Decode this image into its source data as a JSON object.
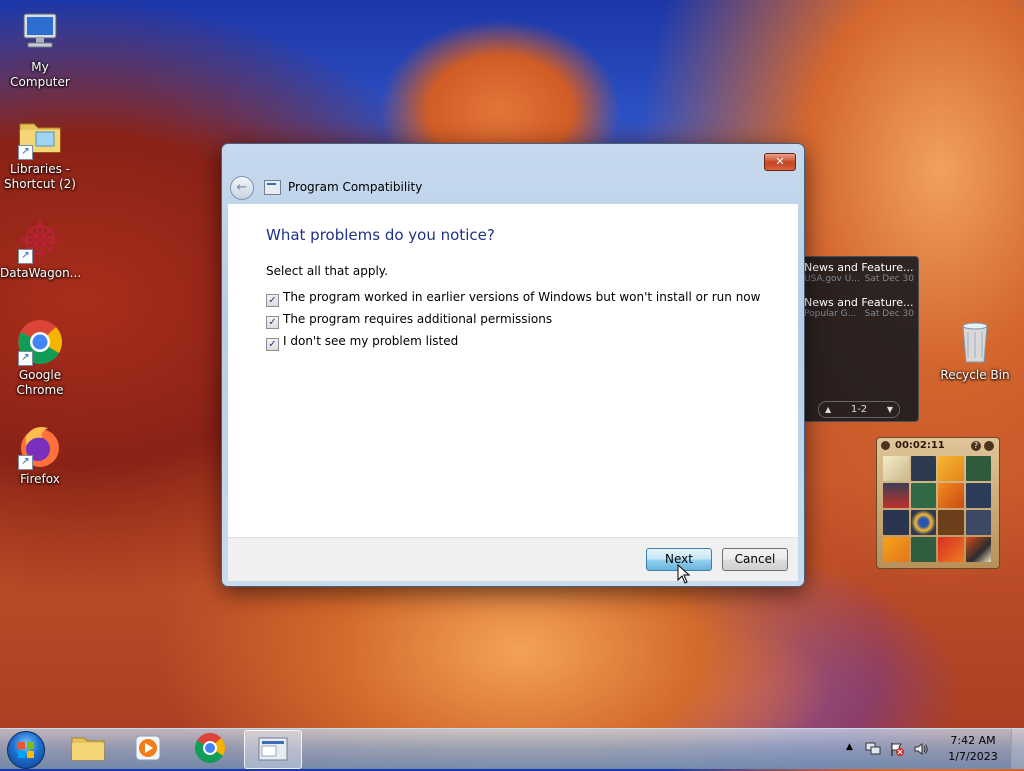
{
  "desktop": {
    "icons": [
      {
        "label": "My Computer"
      },
      {
        "label": "Libraries - Shortcut (2)"
      },
      {
        "label": "DataWagon..."
      },
      {
        "label": "Google Chrome"
      },
      {
        "label": "Firefox"
      },
      {
        "label": "Recycle Bin"
      }
    ]
  },
  "dialog": {
    "title": "Program Compatibility",
    "close_glyph": "✕",
    "back_glyph": "←",
    "heading": "What problems do you notice?",
    "instruction": "Select all that apply.",
    "options": [
      {
        "label": "The program worked in earlier versions of Windows but won't install or run now",
        "checked": true
      },
      {
        "label": "The program requires additional permissions",
        "checked": true
      },
      {
        "label": "I don't see my problem listed",
        "checked": true
      }
    ],
    "next_label": "Next",
    "cancel_label": "Cancel",
    "check_glyph": "✓"
  },
  "feed_gadget": {
    "items": [
      {
        "title": "News and Feature...",
        "source": "USA.gov U...",
        "date": "Sat Dec 30"
      },
      {
        "title": "News and Feature...",
        "source": "Popular G...",
        "date": "Sat Dec 30"
      }
    ],
    "pager": "1-2",
    "prev_glyph": "▲",
    "next_glyph": "▼"
  },
  "puzzle_gadget": {
    "time": "00:02:11"
  },
  "taskbar": {
    "pinned": [
      {
        "name": "windows-explorer"
      },
      {
        "name": "windows-media-player"
      },
      {
        "name": "google-chrome"
      },
      {
        "name": "program-compatibility",
        "active": true
      }
    ],
    "tray_arrow": "▲",
    "clock_time": "7:42 AM",
    "clock_date": "1/7/2023"
  }
}
